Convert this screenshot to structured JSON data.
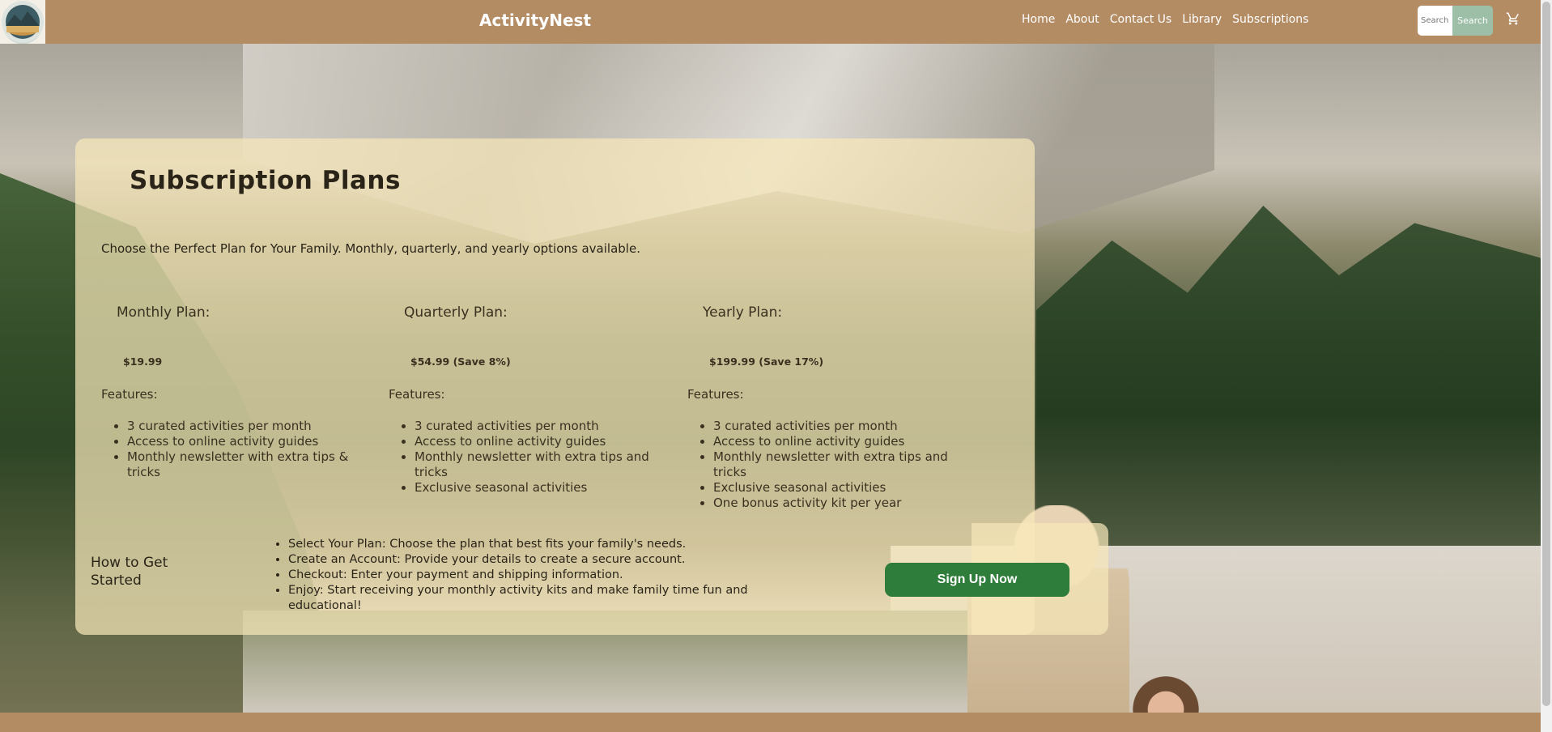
{
  "header": {
    "brand": "ActivityNest",
    "nav": [
      "Home",
      "About",
      "Contact Us",
      "Library",
      "Subscriptions"
    ],
    "search_placeholder": "Search",
    "search_button": "Search"
  },
  "main": {
    "title": "Subscription Plans",
    "subtitle": "Choose the Perfect Plan for Your Family. Monthly, quarterly, and yearly options available.",
    "plans": [
      {
        "name": "Monthly Plan:",
        "price": "$19.99",
        "features_label": "Features:",
        "features": [
          "3 curated activities per month",
          "Access to online activity guides",
          "Monthly newsletter with extra tips & tricks"
        ]
      },
      {
        "name": "Quarterly Plan:",
        "price": "$54.99 (Save 8%)",
        "features_label": "Features:",
        "features": [
          "3 curated activities per month",
          "Access to online activity guides",
          "Monthly newsletter with extra tips and tricks",
          "Exclusive seasonal activities"
        ]
      },
      {
        "name": "Yearly Plan:",
        "price": "$199.99 (Save 17%)",
        "features_label": "Features:",
        "features": [
          "3 curated activities per month",
          "Access to online activity guides",
          "Monthly newsletter with extra tips and tricks",
          "Exclusive seasonal activities",
          "One bonus activity kit per year"
        ]
      }
    ],
    "how_to": {
      "title": "How to Get Started",
      "steps": [
        "Select Your Plan: Choose the plan that best fits your family's needs.",
        "Create an Account: Provide your details to create a secure account.",
        "Checkout: Enter your payment and shipping information.",
        "Enjoy: Start receiving your monthly activity kits and make family time fun and educational!"
      ]
    },
    "cta": "Sign Up Now"
  },
  "colors": {
    "header_bg": "#b48c64",
    "card_bg": "#f6e8ba",
    "cta_bg": "#2e7d3a",
    "search_btn_bg": "#9dbfa8"
  },
  "icons": {
    "cart": "shopping-cart-icon",
    "logo": "mountain-lake-logo"
  }
}
